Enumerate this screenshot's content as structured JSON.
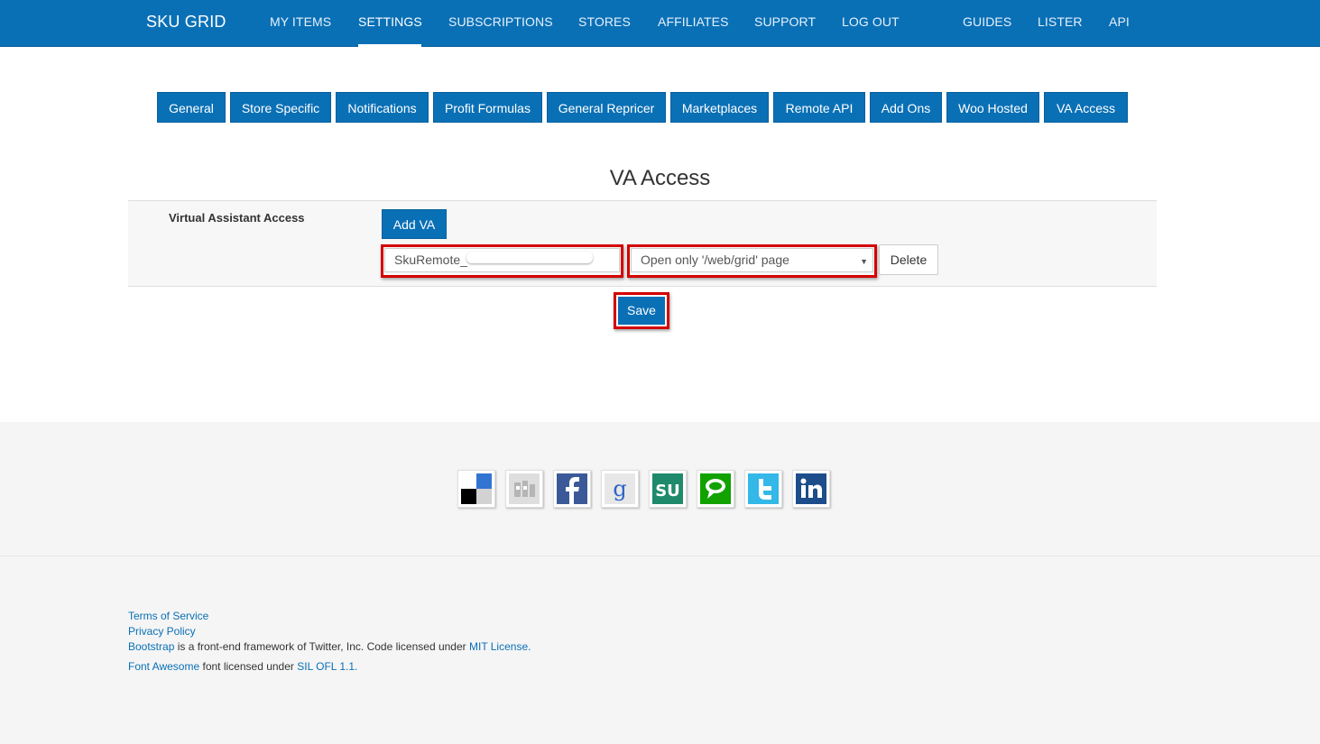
{
  "nav": {
    "brand": "SKU GRID",
    "items": [
      {
        "label": "MY ITEMS"
      },
      {
        "label": "SETTINGS"
      },
      {
        "label": "SUBSCRIPTIONS"
      },
      {
        "label": "STORES"
      },
      {
        "label": "AFFILIATES"
      },
      {
        "label": "SUPPORT"
      },
      {
        "label": "LOG OUT"
      },
      {
        "label": "GUIDES"
      },
      {
        "label": "LISTER"
      },
      {
        "label": "API"
      }
    ],
    "active": "SETTINGS"
  },
  "tabs": [
    {
      "label": "General"
    },
    {
      "label": "Store Specific"
    },
    {
      "label": "Notifications"
    },
    {
      "label": "Profit Formulas"
    },
    {
      "label": "General Repricer"
    },
    {
      "label": "Marketplaces"
    },
    {
      "label": "Remote API"
    },
    {
      "label": "Add Ons"
    },
    {
      "label": "Woo Hosted"
    },
    {
      "label": "VA Access"
    }
  ],
  "page": {
    "title": "VA Access",
    "row_label": "Virtual Assistant Access",
    "add_button": "Add VA",
    "va_username": "SkuRemote_",
    "access_select_value": "Open only '/web/grid' page",
    "delete_button": "Delete",
    "save_button": "Save"
  },
  "colors": {
    "brand_blue": "#0a70b6",
    "highlight_red": "#d40000",
    "footer_bg": "#f5f5f5"
  },
  "social_icons": [
    {
      "name": "delicious-icon"
    },
    {
      "name": "digg-icon"
    },
    {
      "name": "facebook-icon"
    },
    {
      "name": "google-icon"
    },
    {
      "name": "stumbleupon-icon"
    },
    {
      "name": "technorati-icon"
    },
    {
      "name": "twitter-icon"
    },
    {
      "name": "linkedin-icon"
    }
  ],
  "footer": {
    "terms": "Terms of Service",
    "privacy": "Privacy Policy",
    "bootstrap_link": "Bootstrap",
    "bootstrap_text": " is a front-end framework of Twitter, Inc. Code licensed under ",
    "mit_link": "MIT License",
    "period1": ".",
    "fa_link": "Font Awesome",
    "fa_text": " font licensed under ",
    "ofl_link": "SIL OFL 1.1",
    "period2": "."
  }
}
